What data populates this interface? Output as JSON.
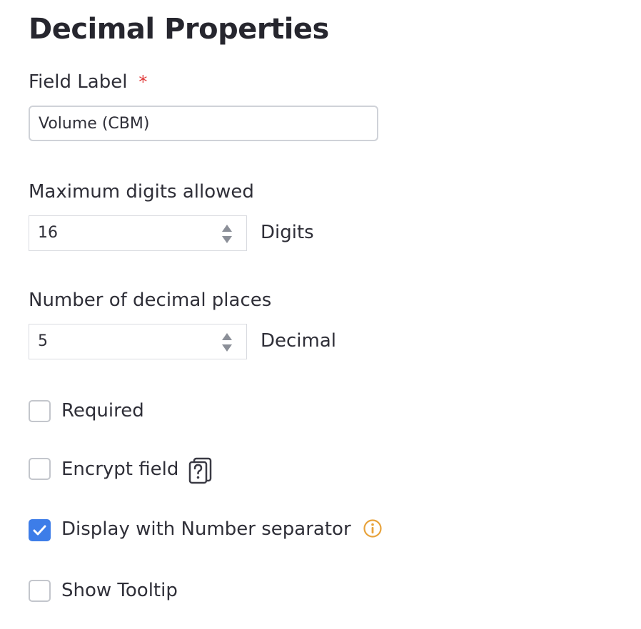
{
  "title": "Decimal Properties",
  "field_label": {
    "label": "Field Label",
    "required_marker": "*",
    "value": "Volume (CBM)"
  },
  "max_digits": {
    "label": "Maximum digits allowed",
    "value": "16",
    "unit": "Digits"
  },
  "decimal_places": {
    "label": "Number of decimal places",
    "value": "5",
    "unit": "Decimal"
  },
  "options": {
    "required": {
      "label": "Required",
      "checked": false
    },
    "encrypt": {
      "label": "Encrypt field",
      "checked": false,
      "icon": "encrypt-help-icon"
    },
    "number_separator": {
      "label": "Display with Number separator",
      "checked": true,
      "icon": "info-icon"
    },
    "tooltip": {
      "label": "Show Tooltip",
      "checked": false
    }
  },
  "colors": {
    "accent": "#3d7de8",
    "required_star": "#e03a3a",
    "info_icon": "#e8a33c"
  }
}
